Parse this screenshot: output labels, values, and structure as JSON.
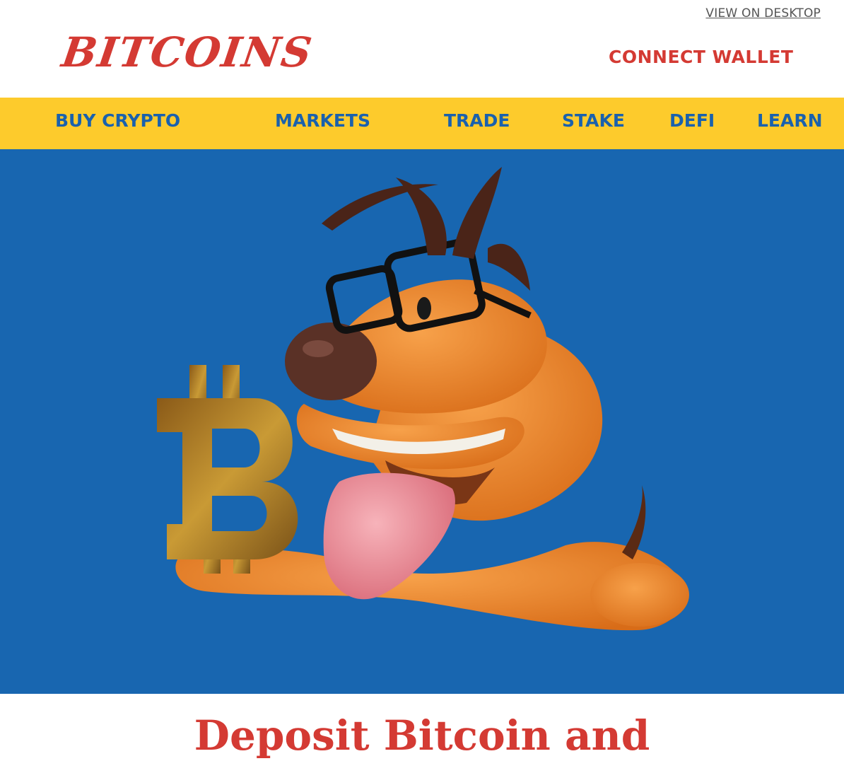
{
  "header": {
    "view_on_desktop": "VIEW ON DESKTOP",
    "logo": "BITCOINS",
    "connect_wallet": "CONNECT WALLET"
  },
  "nav": {
    "items": [
      {
        "label": "BUY CRYPTO"
      },
      {
        "label": "MARKETS"
      },
      {
        "label": "TRADE"
      },
      {
        "label": "STAKE"
      },
      {
        "label": "DEFI"
      },
      {
        "label": "LEARN"
      }
    ]
  },
  "hero": {
    "image": "cartoon-dog-with-glasses-holding-bitcoin-symbol",
    "symbol": "B",
    "background": "#1866b0"
  },
  "main": {
    "headline": "Deposit Bitcoin and"
  },
  "colors": {
    "accent_red": "#d43a33",
    "nav_yellow": "#fdcb2c",
    "nav_blue": "#1a61ad",
    "dog_orange": "#e8802a",
    "coin_gold": "#b8892a"
  }
}
